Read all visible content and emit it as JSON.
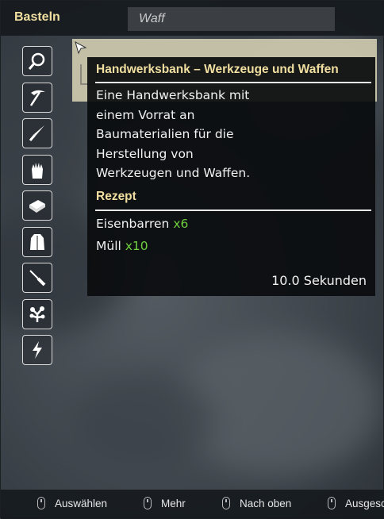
{
  "header": {
    "title": "Basteln",
    "search_value": "Waff"
  },
  "categories": [
    {
      "icon": "magnifier-icon"
    },
    {
      "icon": "pickaxe-icon"
    },
    {
      "icon": "knife-icon"
    },
    {
      "icon": "glove-icon"
    },
    {
      "icon": "book-icon"
    },
    {
      "icon": "armor-icon"
    },
    {
      "icon": "screwdriver-icon"
    },
    {
      "icon": "plant-icon"
    },
    {
      "icon": "lightning-icon"
    }
  ],
  "tooltip": {
    "title": "Handwerksbank – Werkzeuge und Waffen",
    "description": "Eine Handwerksbank mit\neinem Vorrat an\nBaumaterialien für die\nHerstellung von\nWerkzeugen und Waffen.",
    "recipe_heading": "Rezept",
    "ingredients": [
      {
        "name": "Eisenbarren",
        "qty": "x6"
      },
      {
        "name": "Müll",
        "qty": "x10"
      }
    ],
    "time": "10.0 Sekunden"
  },
  "footer": {
    "hints": [
      {
        "label": "Auswählen"
      },
      {
        "label": "Mehr"
      },
      {
        "label": "Nach oben"
      },
      {
        "label": "Ausgeschaltet"
      }
    ]
  },
  "colors": {
    "accent": "#f0dfa0",
    "quantity": "#6fcf3f",
    "text": "#f2f2f2"
  }
}
